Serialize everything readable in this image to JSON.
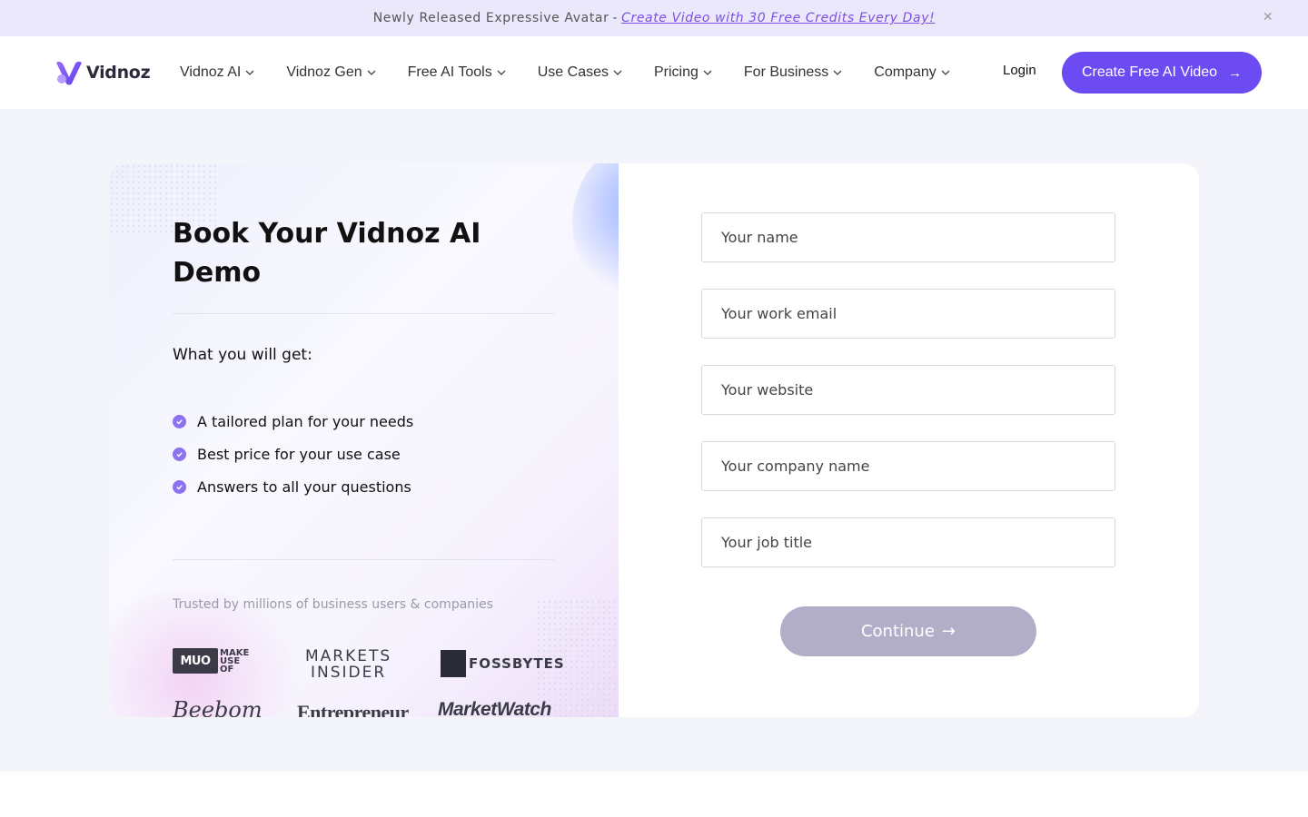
{
  "announcement": {
    "text": "Newly Released Expressive Avatar",
    "separator": "-",
    "link_text": "Create Video with 30 Free Credits Every Day!",
    "close_icon": "close-icon"
  },
  "header": {
    "logo_text": "Vidnoz",
    "nav": [
      {
        "label": "Vidnoz AI"
      },
      {
        "label": "Vidnoz Gen"
      },
      {
        "label": "Free AI Tools"
      },
      {
        "label": "Use Cases"
      },
      {
        "label": "Pricing"
      },
      {
        "label": "For Business"
      },
      {
        "label": "Company"
      }
    ],
    "login": "Login",
    "cta": "Create Free AI Video"
  },
  "demo": {
    "title": "Book Your Vidnoz AI Demo",
    "subtitle": "What you will get:",
    "benefits": [
      "A tailored plan for your needs",
      "Best price for your use case",
      "Answers to all your questions"
    ],
    "trusted": "Trusted by millions of business users & companies",
    "logos": {
      "muo_box": "MUO",
      "muo_text": [
        "MAKE",
        "USE",
        "OF"
      ],
      "markets": [
        "MARKETS",
        "INSIDER"
      ],
      "fossbytes": "FOSSBYTES",
      "beebom": "Beebom",
      "entrepreneur": "Entrepreneur",
      "marketwatch": "MarketWatch"
    }
  },
  "form": {
    "name_placeholder": "Your name",
    "email_placeholder": "Your work email",
    "website_placeholder": "Your website",
    "company_placeholder": "Your company name",
    "job_placeholder": "Your job title",
    "continue": "Continue"
  },
  "colors": {
    "accent": "#6c4bf2",
    "announcement_bg": "#ece8fb",
    "link": "#7b4fe0",
    "continue_disabled": "#b3aec8",
    "check": "#8c72ef"
  }
}
